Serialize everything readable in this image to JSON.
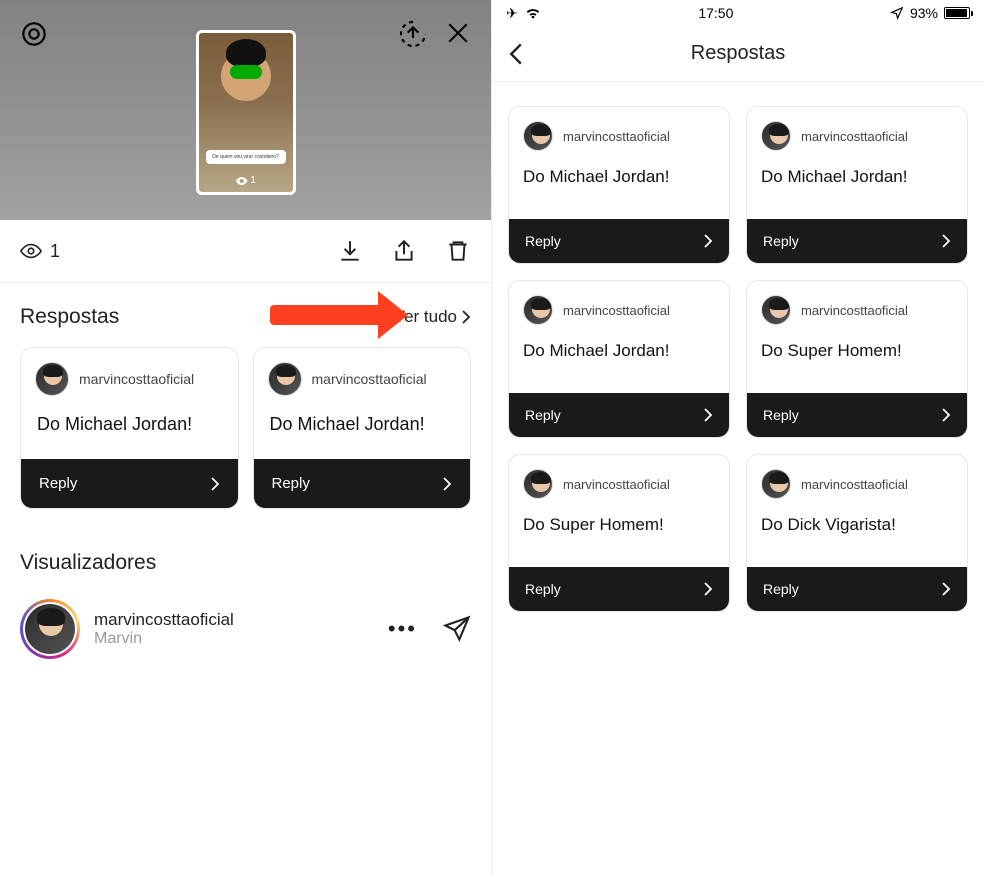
{
  "left": {
    "view_count": "1",
    "story_question": "De quem vou virar costoleiro?",
    "thumb_view_count": "1",
    "responses_title": "Respostas",
    "see_all": "Ver tudo",
    "cards": [
      {
        "username": "marvincosttaoficial",
        "answer": "Do Michael Jordan!",
        "reply_label": "Reply"
      },
      {
        "username": "marvincosttaoficial",
        "answer": "Do Michael Jordan!",
        "reply_label": "Reply"
      }
    ],
    "viewers_title": "Visualizadores",
    "viewer": {
      "username": "marvincosttaoficial",
      "name": "Marvin"
    }
  },
  "right": {
    "status": {
      "time": "17:50",
      "battery": "93%"
    },
    "nav_title": "Respostas",
    "cards": [
      {
        "username": "marvincosttaoficial",
        "answer": "Do Michael Jordan!",
        "reply_label": "Reply"
      },
      {
        "username": "marvincosttaoficial",
        "answer": "Do Michael Jordan!",
        "reply_label": "Reply"
      },
      {
        "username": "marvincosttaoficial",
        "answer": "Do Michael Jordan!",
        "reply_label": "Reply"
      },
      {
        "username": "marvincosttaoficial",
        "answer": "Do Super Homem!",
        "reply_label": "Reply"
      },
      {
        "username": "marvincosttaoficial",
        "answer": "Do Super Homem!",
        "reply_label": "Reply"
      },
      {
        "username": "marvincosttaoficial",
        "answer": "Do Dick Vigarista!",
        "reply_label": "Reply"
      }
    ]
  }
}
